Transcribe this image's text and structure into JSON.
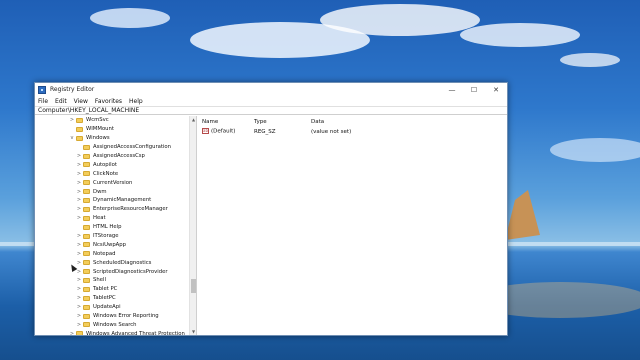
{
  "window": {
    "title": "Registry Editor",
    "controls": {
      "minimize": "—",
      "maximize": "☐",
      "close": "✕"
    }
  },
  "menu": [
    "File",
    "Edit",
    "View",
    "Favorites",
    "Help"
  ],
  "address": "Computer\\HKEY_LOCAL_MACHINE",
  "tree": [
    {
      "label": "WcmSvc",
      "indent": 1,
      "expander": ">"
    },
    {
      "label": "WIMMount",
      "indent": 1,
      "expander": ""
    },
    {
      "label": "Windows",
      "indent": 1,
      "expander": "v"
    },
    {
      "label": "AssignedAccessConfiguration",
      "indent": 2,
      "expander": ""
    },
    {
      "label": "AssignedAccessCsp",
      "indent": 2,
      "expander": ">"
    },
    {
      "label": "Autopilot",
      "indent": 2,
      "expander": ">"
    },
    {
      "label": "ClickNote",
      "indent": 2,
      "expander": ">"
    },
    {
      "label": "CurrentVersion",
      "indent": 2,
      "expander": ">"
    },
    {
      "label": "Dwm",
      "indent": 2,
      "expander": ">"
    },
    {
      "label": "DynamicManagement",
      "indent": 2,
      "expander": ">"
    },
    {
      "label": "EnterpriseResourceManager",
      "indent": 2,
      "expander": ">"
    },
    {
      "label": "Heat",
      "indent": 2,
      "expander": ">"
    },
    {
      "label": "HTML Help",
      "indent": 2,
      "expander": ""
    },
    {
      "label": "ITStorage",
      "indent": 2,
      "expander": ">"
    },
    {
      "label": "NcsiUwpApp",
      "indent": 2,
      "expander": ">"
    },
    {
      "label": "Notepad",
      "indent": 2,
      "expander": ">"
    },
    {
      "label": "ScheduledDiagnostics",
      "indent": 2,
      "expander": ">"
    },
    {
      "label": "ScriptedDiagnosticsProvider",
      "indent": 2,
      "expander": ">"
    },
    {
      "label": "Shell",
      "indent": 2,
      "expander": ">"
    },
    {
      "label": "Tablet PC",
      "indent": 2,
      "expander": ">"
    },
    {
      "label": "TabletPC",
      "indent": 2,
      "expander": ">"
    },
    {
      "label": "UpdateApi",
      "indent": 2,
      "expander": ">"
    },
    {
      "label": "Windows Error Reporting",
      "indent": 2,
      "expander": ">"
    },
    {
      "label": "Windows Search",
      "indent": 2,
      "expander": ">"
    },
    {
      "label": "Windows Advanced Threat Protection",
      "indent": 1,
      "expander": ">"
    }
  ],
  "columns": {
    "name": "Name",
    "type": "Type",
    "data": "Data"
  },
  "values": [
    {
      "name": "(Default)",
      "type": "REG_SZ",
      "data": "(value not set)",
      "icon": "ab-string-icon"
    }
  ]
}
